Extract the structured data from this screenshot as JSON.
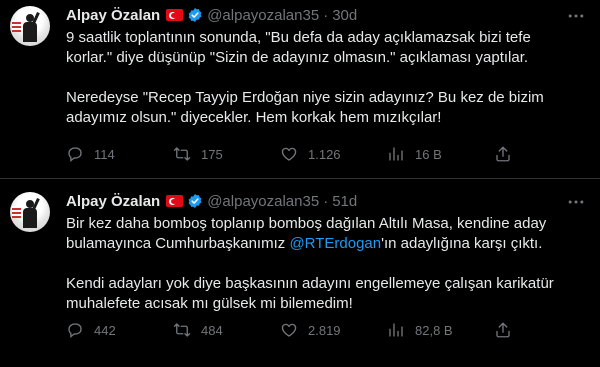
{
  "tweets": [
    {
      "name": "Alpay Özalan",
      "handle": "@alpayozalan35",
      "separator": "·",
      "time": "30d",
      "paragraphs": [
        [
          "9 saatlik toplantının sonunda, \"Bu defa da aday açıklamazsak bizi tefe",
          "korlar.\" diye düşünüp \"Sizin de adayınız olmasın.\" açıklaması yaptılar."
        ],
        [
          "Neredeyse \"Recep Tayyip Erdoğan niye sizin adayınız? Bu kez de bizim",
          "adayımız olsun.\" diyecekler. Hem korkak hem mızıkçılar!"
        ]
      ],
      "stats": {
        "replies": "114",
        "retweets": "175",
        "likes": "1.126",
        "views": "16 B"
      }
    },
    {
      "name": "Alpay Özalan",
      "handle": "@alpayozalan35",
      "separator": "·",
      "time": "51d",
      "line1": "Bir kez daha bomboş toplanıp bomboş dağılan Altılı Masa, kendine aday",
      "line2_before": "bulamayınca Cumhurbaşkanımız ",
      "mention": "@RTErdogan",
      "line2_after": "'ın adaylığına karşı çıktı.",
      "paragraph2": [
        "Kendi adayları yok diye başkasının adayını engellemeye çalışan karikatür",
        "muhalefete acısak mı gülsek mi bilemedim!"
      ],
      "stats": {
        "replies": "442",
        "retweets": "484",
        "likes": "2.819",
        "views": "82,8 B"
      }
    }
  ],
  "icons": {
    "verified": "verified-badge-icon",
    "flag": "turkey-flag-icon",
    "more": "more-options-icon",
    "reply": "reply-icon",
    "retweet": "retweet-icon",
    "like": "like-icon",
    "views": "views-icon",
    "share": "share-icon"
  },
  "colors": {
    "background": "#000000",
    "text": "#e7e9ea",
    "secondary": "#71767b",
    "accent": "#1d9bf0",
    "divider": "#2f3336"
  }
}
